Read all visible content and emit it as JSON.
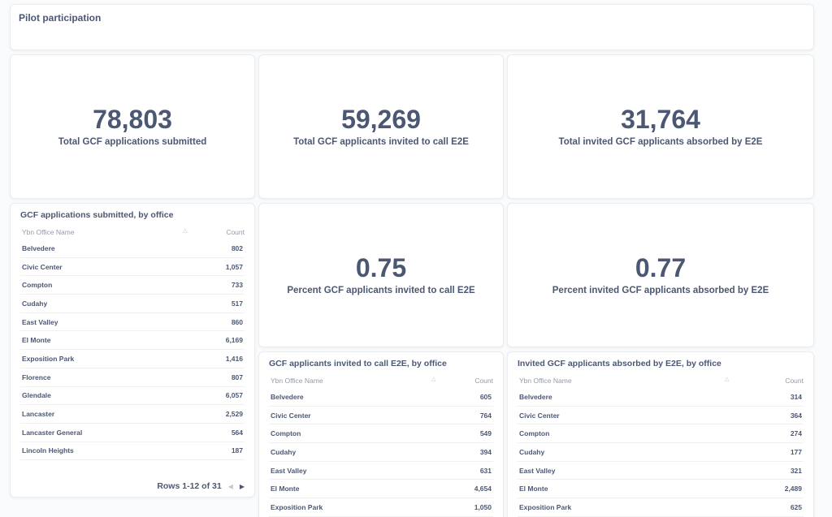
{
  "header": {
    "title": "Pilot participation"
  },
  "scalars": {
    "submitted": {
      "value": "78,803",
      "label": "Total GCF applications submitted"
    },
    "invited": {
      "value": "59,269",
      "label": "Total GCF applicants invited to call E2E"
    },
    "absorbed": {
      "value": "31,764",
      "label": "Total invited GCF applicants absorbed by E2E"
    },
    "pct_invited": {
      "value": "0.75",
      "label": "Percent GCF applicants invited to call E2E"
    },
    "pct_absorbed": {
      "value": "0.77",
      "label": "Percent invited GCF applicants absorbed by E2E"
    }
  },
  "tables": {
    "submitted": {
      "title": "GCF applications submitted, by office",
      "col_name": "Ybn Office Name",
      "col_count": "Count",
      "rows": [
        {
          "name": "Belvedere",
          "count": "802"
        },
        {
          "name": "Civic Center",
          "count": "1,057"
        },
        {
          "name": "Compton",
          "count": "733"
        },
        {
          "name": "Cudahy",
          "count": "517"
        },
        {
          "name": "East Valley",
          "count": "860"
        },
        {
          "name": "El Monte",
          "count": "6,169"
        },
        {
          "name": "Exposition Park",
          "count": "1,416"
        },
        {
          "name": "Florence",
          "count": "807"
        },
        {
          "name": "Glendale",
          "count": "6,057"
        },
        {
          "name": "Lancaster",
          "count": "2,529"
        },
        {
          "name": "Lancaster General",
          "count": "564"
        },
        {
          "name": "Lincoln Heights",
          "count": "187"
        }
      ],
      "pager": "Rows 1-12 of 31"
    },
    "invited": {
      "title": "GCF applicants invited to call E2E, by office",
      "col_name": "Ybn Office Name",
      "col_count": "Count",
      "rows": [
        {
          "name": "Belvedere",
          "count": "605"
        },
        {
          "name": "Civic Center",
          "count": "764"
        },
        {
          "name": "Compton",
          "count": "549"
        },
        {
          "name": "Cudahy",
          "count": "394"
        },
        {
          "name": "East Valley",
          "count": "631"
        },
        {
          "name": "El Monte",
          "count": "4,654"
        },
        {
          "name": "Exposition Park",
          "count": "1,050"
        }
      ]
    },
    "absorbed": {
      "title": "Invited GCF applicants absorbed by E2E, by office",
      "col_name": "Ybn Office Name",
      "col_count": "Count",
      "rows": [
        {
          "name": "Belvedere",
          "count": "314"
        },
        {
          "name": "Civic Center",
          "count": "364"
        },
        {
          "name": "Compton",
          "count": "274"
        },
        {
          "name": "Cudahy",
          "count": "177"
        },
        {
          "name": "East Valley",
          "count": "321"
        },
        {
          "name": "El Monte",
          "count": "2,489"
        },
        {
          "name": "Exposition Park",
          "count": "625"
        }
      ]
    }
  },
  "icons": {
    "sort": "sort-chevron-icon",
    "prev": "chevron-left-icon",
    "next": "chevron-right-icon"
  }
}
